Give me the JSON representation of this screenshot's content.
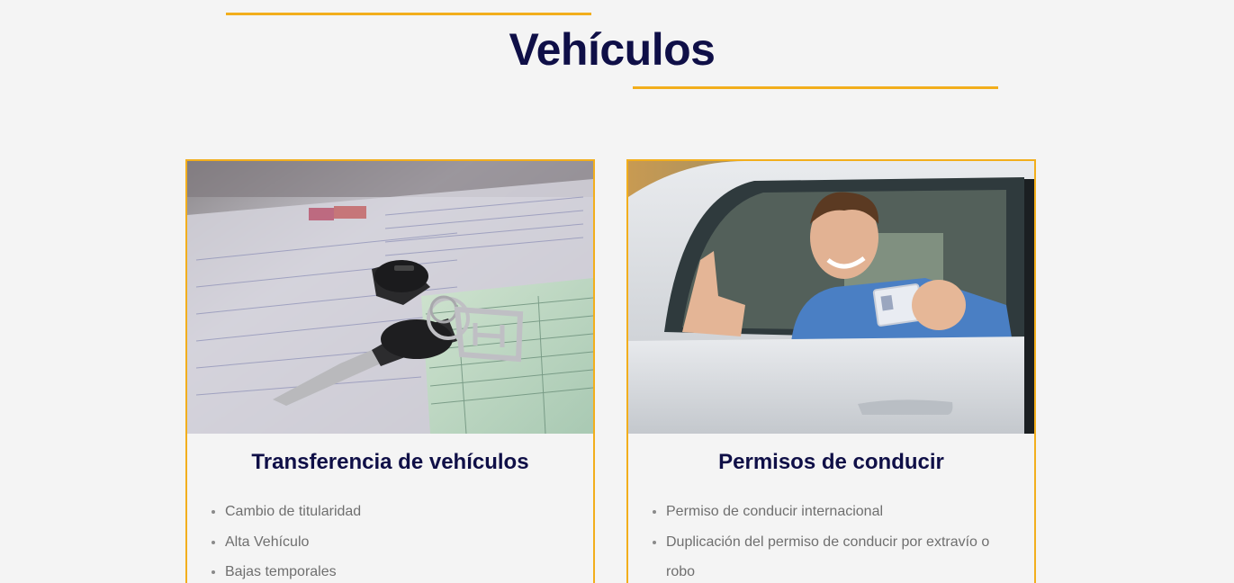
{
  "section": {
    "title": "Vehículos"
  },
  "colors": {
    "accent": "#f2ae1c",
    "title": "#0f0f47",
    "text": "#6f6f6f",
    "background": "#f4f4f4"
  },
  "cards": [
    {
      "image": "car-keys-on-documents-photo",
      "title": "Transferencia de vehículos",
      "items": [
        "Cambio de titularidad",
        "Alta Vehículo",
        "Bajas temporales"
      ]
    },
    {
      "image": "man-in-car-showing-license-photo",
      "title": "Permisos de conducir",
      "items": [
        "Permiso de conducir internacional",
        "Duplicación del permiso de conducir por extravío o robo"
      ]
    }
  ]
}
